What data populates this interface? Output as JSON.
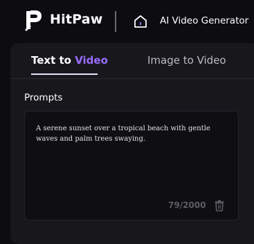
{
  "header": {
    "brand_name": "HitPaw",
    "app_title": "AI Video Generator",
    "icons": {
      "logo": "hitpaw-logo-icon",
      "home": "home-icon"
    }
  },
  "tabs": [
    {
      "label_primary": "Text to ",
      "label_accent": "Video",
      "active": true
    },
    {
      "label": "Image to Video",
      "active": false
    }
  ],
  "prompts": {
    "label": "Prompts",
    "value": "A serene sunset over a tropical beach with gentle waves and palm trees swaying.",
    "char_count": "79/2000",
    "delete_icon": "trash-icon"
  },
  "colors": {
    "background": "#0d0c10",
    "panel": "#18171c",
    "accent": "#9a6dff",
    "muted_text": "#5d5c63"
  }
}
